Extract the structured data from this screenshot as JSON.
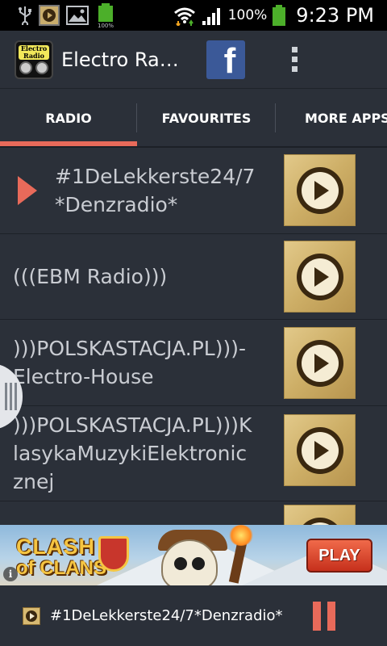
{
  "status_bar": {
    "battery_percent": "100%",
    "time": "9:23 PM",
    "icons": [
      "usb-icon",
      "media-notification-icon",
      "image-notification-icon",
      "battery-notification-icon",
      "wifi-icon",
      "signal-icon",
      "battery-icon"
    ]
  },
  "action_bar": {
    "title": "Electro Radio",
    "logo_text": "Electro Radio",
    "facebook_label": "f"
  },
  "tabs": [
    {
      "label": "RADIO",
      "selected": true
    },
    {
      "label": "FAVOURITES",
      "selected": false
    },
    {
      "label": "MORE APPS",
      "selected": false
    }
  ],
  "stations": [
    {
      "name": "#1DeLekkerste24/7*Denzradio*",
      "playing": true
    },
    {
      "name": "(((EBM Radio)))",
      "playing": false
    },
    {
      "name": ")))POLSKASTACJA.PL)))-Electro-House",
      "playing": false
    },
    {
      "name": ")))POLSKASTACJA.PL)))KlasykaMuzykiElektronicznej",
      "playing": false
    },
    {
      "name": "",
      "playing": false
    }
  ],
  "ad": {
    "logo_line1": "CLASH",
    "logo_line2": "of CLANS",
    "cta": "PLAY",
    "info": "i"
  },
  "now_playing": {
    "title": "#1DeLekkerste24/7*Denzradio*"
  },
  "colors": {
    "accent": "#e86a5a",
    "background": "#2b3039",
    "tile": "#cdae66"
  }
}
